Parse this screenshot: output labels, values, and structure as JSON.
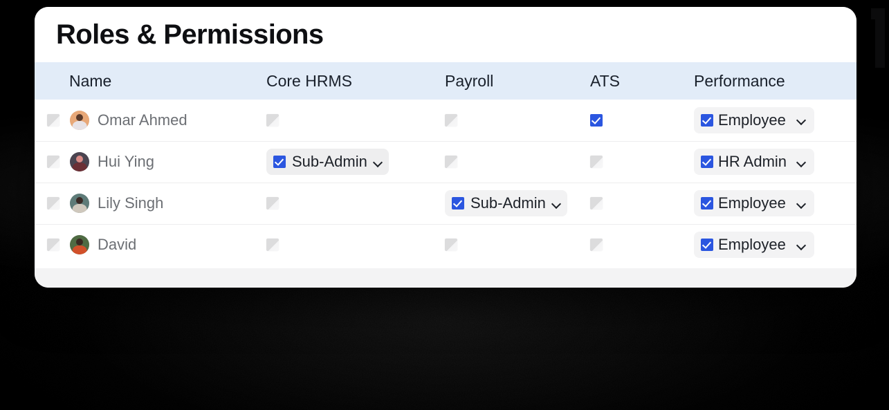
{
  "card": {
    "title": "Roles & Permissions"
  },
  "table": {
    "columns": [
      {
        "key": "name",
        "label": "Name"
      },
      {
        "key": "core_hrms",
        "label": "Core HRMS"
      },
      {
        "key": "payroll",
        "label": "Payroll"
      },
      {
        "key": "ats",
        "label": "ATS"
      },
      {
        "key": "performance",
        "label": "Performance"
      }
    ],
    "rows": [
      {
        "name": "Omar Ahmed",
        "select_checked": false,
        "core_hrms": {
          "checked": false,
          "label": ""
        },
        "payroll": {
          "checked": false,
          "label": ""
        },
        "ats": {
          "checked": true,
          "label": ""
        },
        "performance": {
          "checked": true,
          "label": "Employee"
        }
      },
      {
        "name": "Hui Ying",
        "select_checked": false,
        "core_hrms": {
          "checked": true,
          "label": "Sub-Admin"
        },
        "payroll": {
          "checked": false,
          "label": ""
        },
        "ats": {
          "checked": false,
          "label": ""
        },
        "performance": {
          "checked": true,
          "label": "HR Admin"
        }
      },
      {
        "name": "Lily Singh",
        "select_checked": false,
        "core_hrms": {
          "checked": false,
          "label": ""
        },
        "payroll": {
          "checked": true,
          "label": "Sub-Admin"
        },
        "ats": {
          "checked": false,
          "label": ""
        },
        "performance": {
          "checked": true,
          "label": "Employee"
        }
      },
      {
        "name": "David",
        "select_checked": false,
        "core_hrms": {
          "checked": false,
          "label": ""
        },
        "payroll": {
          "checked": false,
          "label": ""
        },
        "ats": {
          "checked": false,
          "label": ""
        },
        "performance": {
          "checked": true,
          "label": "Employee"
        }
      }
    ]
  },
  "avatars": [
    {
      "bg": "#e8a878",
      "head": "#5a3a2a",
      "body": "#e7e2e6"
    },
    {
      "bg": "#4a4450",
      "head": "#d98a86",
      "body": "#6b2f35"
    },
    {
      "bg": "#5e7b78",
      "head": "#3a2a26",
      "body": "#cfc8bd"
    },
    {
      "bg": "#4f6b43",
      "head": "#3a2a22",
      "body": "#d2502a"
    }
  ],
  "colors": {
    "accent_checked": "#2b56e0",
    "header_band": "#e2ecf8",
    "card_bg": "#ffffff",
    "name_text": "#6c6f74",
    "title_text": "#0e0f12",
    "pill_bg": "#eeeeef",
    "row_divider": "#ededee"
  },
  "icons": {
    "chevron_down": "chevron-down-icon",
    "checkbox_checked": "checkbox-checked-icon",
    "checkbox_unchecked": "checkbox-unchecked-icon"
  }
}
